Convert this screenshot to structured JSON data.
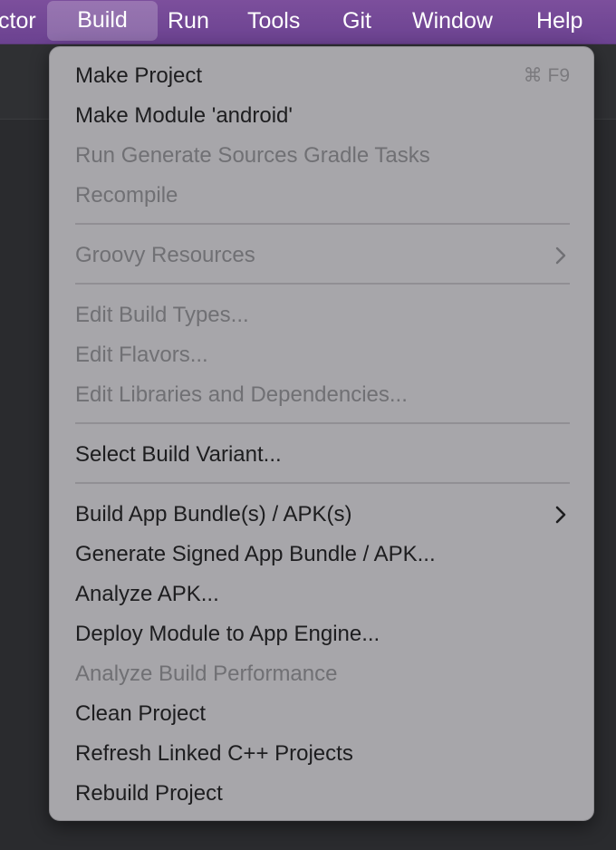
{
  "menubar": {
    "items": [
      {
        "label": "ctor"
      },
      {
        "label": "Build"
      },
      {
        "label": "Run"
      },
      {
        "label": "Tools"
      },
      {
        "label": "Git"
      },
      {
        "label": "Window"
      },
      {
        "label": "Help"
      }
    ]
  },
  "build_menu": {
    "items": [
      {
        "label": "Make Project",
        "enabled": true,
        "shortcut": "⌘ F9"
      },
      {
        "label": "Make Module 'android'",
        "enabled": true
      },
      {
        "label": "Run Generate Sources Gradle Tasks",
        "enabled": false
      },
      {
        "label": "Recompile",
        "enabled": false
      },
      {
        "label": "Groovy Resources",
        "enabled": false,
        "submenu": true
      },
      {
        "label": "Edit Build Types...",
        "enabled": false
      },
      {
        "label": "Edit Flavors...",
        "enabled": false
      },
      {
        "label": "Edit Libraries and Dependencies...",
        "enabled": false
      },
      {
        "label": "Select Build Variant...",
        "enabled": true
      },
      {
        "label": "Build App Bundle(s) / APK(s)",
        "enabled": true,
        "submenu": true
      },
      {
        "label": "Generate Signed App Bundle / APK...",
        "enabled": true
      },
      {
        "label": "Analyze APK...",
        "enabled": true
      },
      {
        "label": "Deploy Module to App Engine...",
        "enabled": true
      },
      {
        "label": "Analyze Build Performance",
        "enabled": false
      },
      {
        "label": "Clean Project",
        "enabled": true
      },
      {
        "label": "Refresh Linked C++ Projects",
        "enabled": true
      },
      {
        "label": "Rebuild Project",
        "enabled": true
      }
    ]
  },
  "colors": {
    "menubar": "#6b4290",
    "dropdown": "#a7a6aa",
    "enabled_text": "#1d1d1f",
    "disabled_text": "#707074"
  }
}
